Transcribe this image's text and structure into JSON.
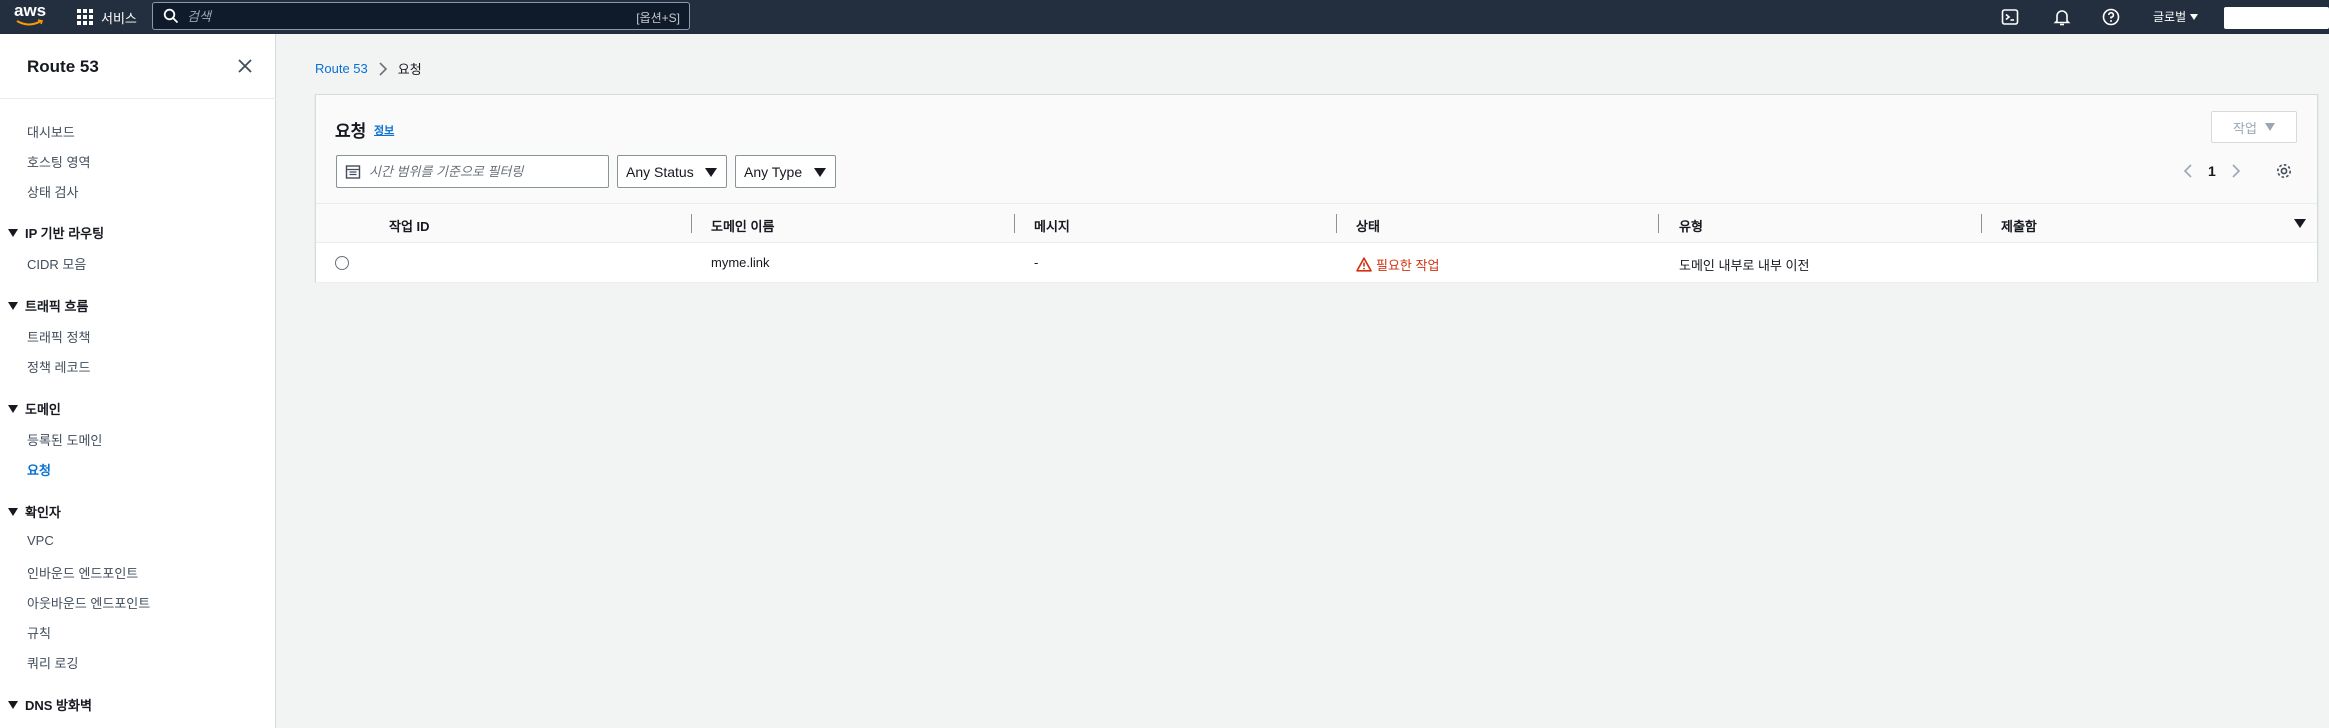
{
  "topnav": {
    "logo_text": "aws",
    "services_label": "서비스",
    "search_placeholder": "검색",
    "search_shortcut": "[옵션+S]",
    "region_label": "글로벌",
    "icons": [
      "cloudshell-icon",
      "bell-icon",
      "help-icon"
    ]
  },
  "sidebar": {
    "title": "Route 53",
    "top_items": [
      "대시보드",
      "호스팅 영역",
      "상태 검사"
    ],
    "groups": [
      {
        "label": "IP 기반 라우팅",
        "items": [
          "CIDR 모음"
        ]
      },
      {
        "label": "트래픽 흐름",
        "items": [
          "트래픽 정책",
          "정책 레코드"
        ]
      },
      {
        "label": "도메인",
        "items": [
          "등록된 도메인",
          "요청"
        ],
        "active": "요청"
      },
      {
        "label": "확인자",
        "items": [
          "VPC",
          "인바운드 엔드포인트",
          "아웃바운드 엔드포인트",
          "규칙",
          "쿼리 로깅"
        ]
      },
      {
        "label": "DNS 방화벽",
        "items": []
      }
    ]
  },
  "breadcrumb": {
    "root": "Route 53",
    "current": "요청"
  },
  "panel": {
    "title": "요청",
    "info_label": "정보",
    "action_label": "작업",
    "filter_placeholder": "시간 범위를 기준으로 필터링",
    "status_filter": "Any Status",
    "type_filter": "Any Type",
    "page_number": "1"
  },
  "table": {
    "columns": [
      "작업 ID",
      "도메인 이름",
      "메시지",
      "상태",
      "유형",
      "제출함"
    ],
    "rows": [
      {
        "operation_id": "",
        "domain": "myme.link",
        "message": "-",
        "status": "필요한 작업",
        "type": "도메인 내부로 내부 이전",
        "submitted": ""
      }
    ]
  },
  "colors": {
    "nav_bg": "#232f3e",
    "link": "#0972d3",
    "warning": "#d13212"
  }
}
